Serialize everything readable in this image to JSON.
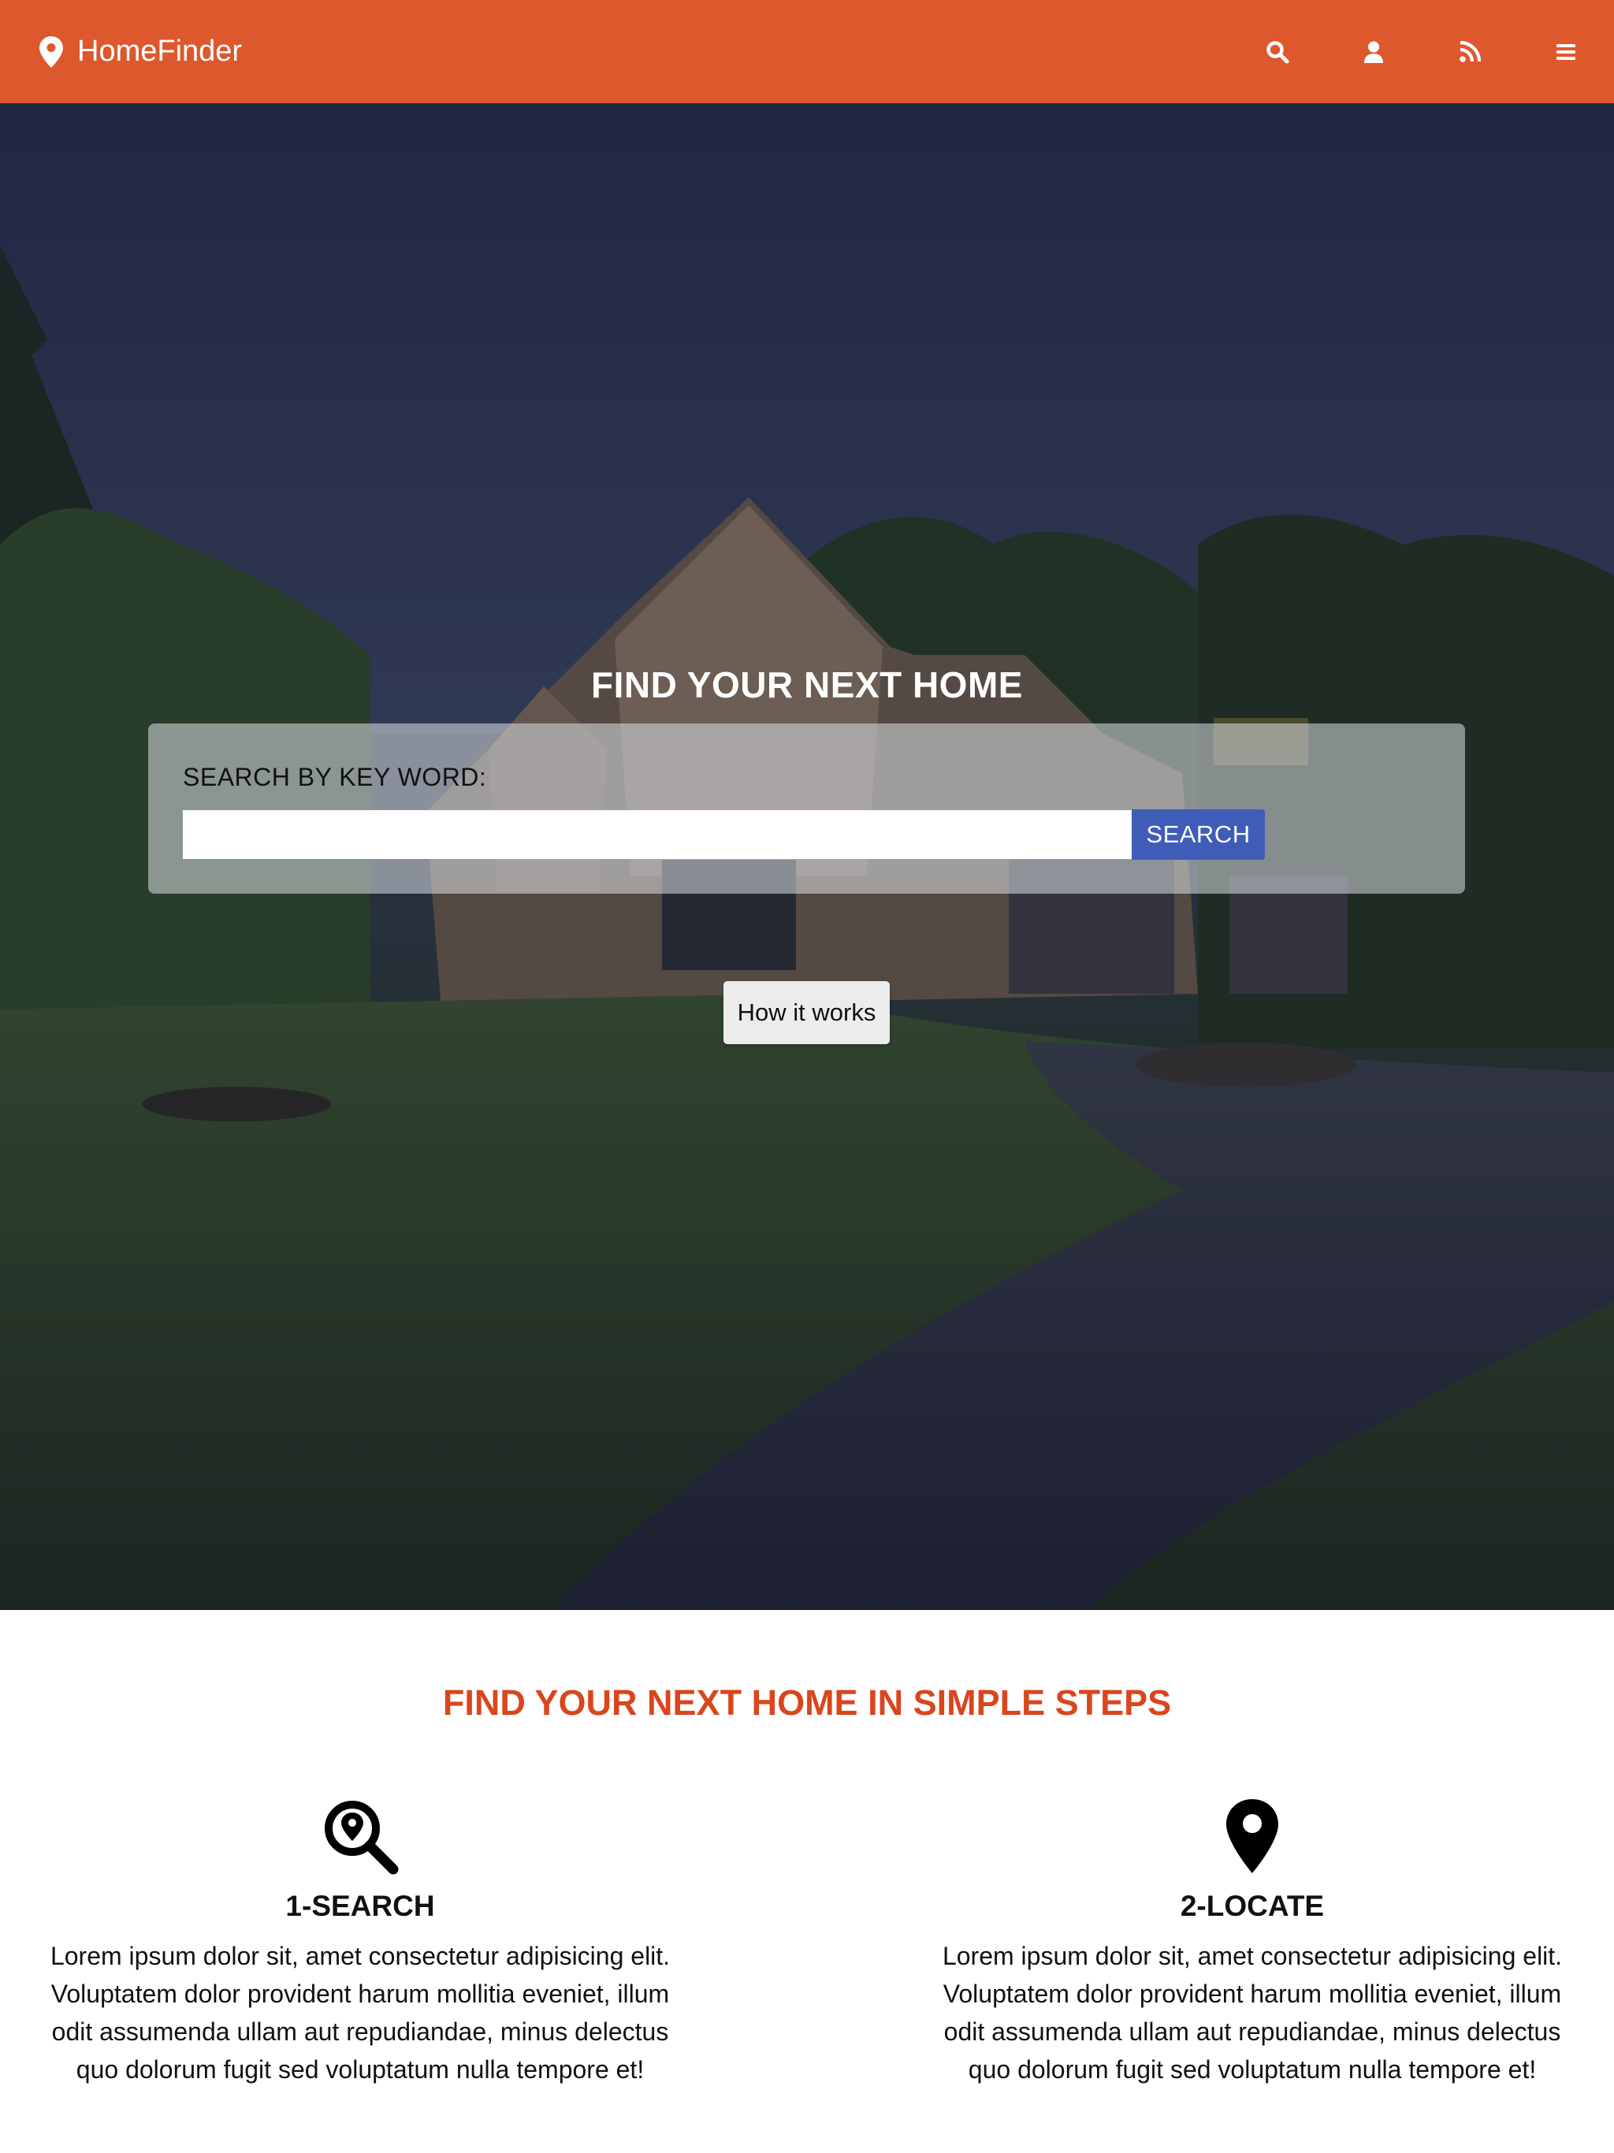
{
  "navbar": {
    "brand": "HomeFinder",
    "brand_icon": "map-marker-icon",
    "icons": [
      "search-icon",
      "user-icon",
      "rss-icon",
      "menu-icon"
    ],
    "background": "#dd582c"
  },
  "hero": {
    "title": "FIND YOUR NEXT HOME",
    "search": {
      "label": "SEARCH BY KEY WORD:",
      "value": "",
      "placeholder": "",
      "button_label": "SEARCH",
      "button_color": "#3f5cb8"
    },
    "how_button_label": "How it works"
  },
  "steps": {
    "title": "FIND YOUR NEXT HOME IN SIMPLE STEPS",
    "title_color": "#d9461d",
    "items": [
      {
        "icon": "search-location-icon",
        "heading": "1-SEARCH",
        "text": "Lorem ipsum dolor sit, amet consectetur adipisicing elit. Voluptatem dolor provident harum mollitia eveniet, illum odit assumenda ullam aut repudiandae, minus delectus quo dolorum fugit sed voluptatum nulla tempore et!"
      },
      {
        "icon": "map-marker-icon",
        "heading": "2-LOCATE",
        "text": "Lorem ipsum dolor sit, amet consectetur adipisicing elit. Voluptatem dolor provident harum mollitia eveniet, illum odit assumenda ullam aut repudiandae, minus delectus quo dolorum fugit sed voluptatum nulla tempore et!"
      }
    ]
  }
}
